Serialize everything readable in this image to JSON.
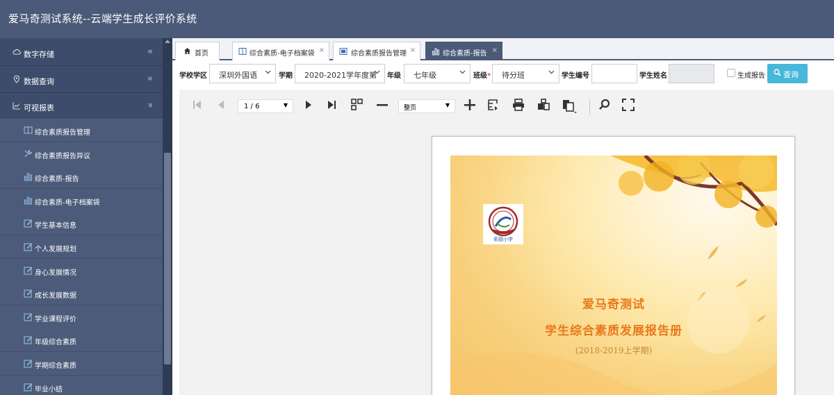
{
  "app": {
    "title": "爱马奇测试系统--云端学生成长评价系统"
  },
  "sidebar": {
    "top_items": [
      {
        "label": "数字存储",
        "icon": "cloud-icon",
        "arrow": "«"
      },
      {
        "label": "数据查询",
        "icon": "map-marker-icon",
        "arrow": "«"
      },
      {
        "label": "可视报表",
        "icon": "line-chart-icon",
        "arrow": "»"
      }
    ],
    "sub_items": [
      {
        "label": "综合素质报告管理",
        "icon": "book-icon"
      },
      {
        "label": "综合素质报告异议",
        "icon": "tools-icon"
      },
      {
        "label": "综合素质-报告",
        "icon": "bar-chart-icon"
      },
      {
        "label": "综合素质-电子档案袋",
        "icon": "bar-chart-icon"
      },
      {
        "label": "学生基本信息",
        "icon": "edit-icon"
      },
      {
        "label": "个人发展规划",
        "icon": "edit-icon"
      },
      {
        "label": "身心发展情况",
        "icon": "edit-icon"
      },
      {
        "label": "成长发展数据",
        "icon": "edit-icon"
      },
      {
        "label": "学业课程评价",
        "icon": "edit-icon"
      },
      {
        "label": "年级综合素质",
        "icon": "edit-icon"
      },
      {
        "label": "学期综合素质",
        "icon": "edit-icon"
      },
      {
        "label": "毕业小结",
        "icon": "edit-icon"
      }
    ]
  },
  "tabs": {
    "home": "首页",
    "items": [
      {
        "label": "综合素质-电子档案袋",
        "close": "×"
      },
      {
        "label": "综合素质报告管理",
        "close": "×"
      },
      {
        "label": "综合素质-报告",
        "close": "×"
      }
    ]
  },
  "filters": {
    "school_label": "学校学区",
    "school_value": "深圳外国语",
    "term_label": "学期",
    "term_value": "2020-2021学年度第",
    "grade_label": "年级",
    "grade_value": "七年级",
    "class_label": "班级",
    "class_required": "*",
    "class_value": "待分班",
    "student_no_label": "学生编号",
    "student_no_value": "",
    "student_name_label": "学生姓名",
    "student_name_value": "",
    "generate_label": "生成报告",
    "search_label": "查询"
  },
  "viewer": {
    "page_indicator": "1 / 6",
    "zoom_value": "整页"
  },
  "report": {
    "logo_text": "莉德小学",
    "title1": "爱马奇测试",
    "title2": "学生综合素质发展报告册",
    "period": "(2018-2019上学期)"
  },
  "colors": {
    "header": "#4a5a78",
    "sidebar": "#3c4c6a",
    "search_button": "#46b8da",
    "title_text": "#e8791a"
  }
}
